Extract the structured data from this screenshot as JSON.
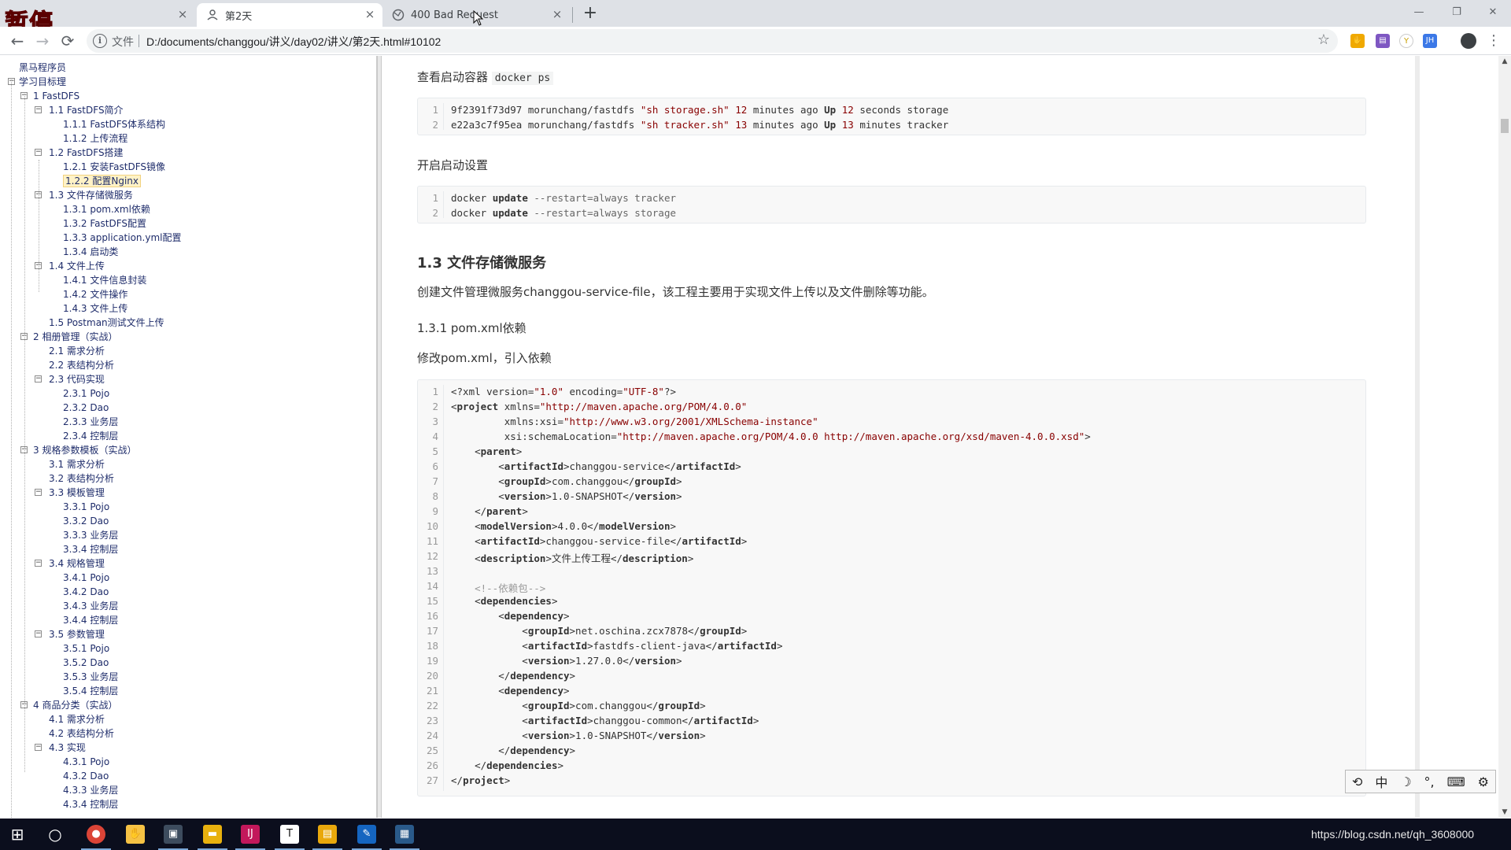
{
  "overlay": {
    "pause_label": "暂停"
  },
  "browser": {
    "tabs": [
      {
        "title": "",
        "close": "×"
      },
      {
        "title": "第2天",
        "close": "×"
      },
      {
        "title": "400 Bad Request",
        "close": "×"
      }
    ],
    "new_tab": "+",
    "window_controls": {
      "minimize": "—",
      "restore": "❐",
      "close": "✕"
    },
    "nav": {
      "back": "←",
      "forward": "→",
      "reload": "⟳"
    },
    "address": {
      "info": "i",
      "scheme_label": "文件",
      "url": "D:/documents/changgou/讲义/day02/讲义/第2天.html#10102",
      "star": "☆"
    },
    "menu": "⋮"
  },
  "toc": {
    "items": [
      {
        "label": "黑马程序员",
        "level": 0
      },
      {
        "label": "学习目标理",
        "level": 0
      },
      {
        "label": "1 FastDFS",
        "level": 1
      },
      {
        "label": "1.1 FastDFS简介",
        "level": 2
      },
      {
        "label": "1.1.1 FastDFS体系结构",
        "level": 3
      },
      {
        "label": "1.1.2 上传流程",
        "level": 3
      },
      {
        "label": "1.2 FastDFS搭建",
        "level": 2
      },
      {
        "label": "1.2.1 安装FastDFS镜像",
        "level": 3
      },
      {
        "label": "1.2.2 配置Nginx",
        "level": 3,
        "selected": true
      },
      {
        "label": "1.3 文件存储微服务",
        "level": 2
      },
      {
        "label": "1.3.1 pom.xml依赖",
        "level": 3
      },
      {
        "label": "1.3.2 FastDFS配置",
        "level": 3
      },
      {
        "label": "1.3.3 application.yml配置",
        "level": 3
      },
      {
        "label": "1.3.4 启动类",
        "level": 3
      },
      {
        "label": "1.4 文件上传",
        "level": 2
      },
      {
        "label": "1.4.1 文件信息封装",
        "level": 3
      },
      {
        "label": "1.4.2 文件操作",
        "level": 3
      },
      {
        "label": "1.4.3 文件上传",
        "level": 3
      },
      {
        "label": "1.5 Postman测试文件上传",
        "level": 2
      },
      {
        "label": "2 相册管理（实战）",
        "level": 1
      },
      {
        "label": "2.1 需求分析",
        "level": 2
      },
      {
        "label": "2.2 表结构分析",
        "level": 2
      },
      {
        "label": "2.3 代码实现",
        "level": 2
      },
      {
        "label": "2.3.1 Pojo",
        "level": 3
      },
      {
        "label": "2.3.2 Dao",
        "level": 3
      },
      {
        "label": "2.3.3 业务层",
        "level": 3
      },
      {
        "label": "2.3.4 控制层",
        "level": 3
      },
      {
        "label": "3 规格参数模板（实战）",
        "level": 1
      },
      {
        "label": "3.1 需求分析",
        "level": 2
      },
      {
        "label": "3.2 表结构分析",
        "level": 2
      },
      {
        "label": "3.3 模板管理",
        "level": 2
      },
      {
        "label": "3.3.1 Pojo",
        "level": 3
      },
      {
        "label": "3.3.2 Dao",
        "level": 3
      },
      {
        "label": "3.3.3 业务层",
        "level": 3
      },
      {
        "label": "3.3.4 控制层",
        "level": 3
      },
      {
        "label": "3.4 规格管理",
        "level": 2
      },
      {
        "label": "3.4.1 Pojo",
        "level": 3
      },
      {
        "label": "3.4.2 Dao",
        "level": 3
      },
      {
        "label": "3.4.3 业务层",
        "level": 3
      },
      {
        "label": "3.4.4 控制层",
        "level": 3
      },
      {
        "label": "3.5 参数管理",
        "level": 2
      },
      {
        "label": "3.5.1 Pojo",
        "level": 3
      },
      {
        "label": "3.5.2 Dao",
        "level": 3
      },
      {
        "label": "3.5.3 业务层",
        "level": 3
      },
      {
        "label": "3.5.4 控制层",
        "level": 3
      },
      {
        "label": "4 商品分类（实战）",
        "level": 1
      },
      {
        "label": "4.1 需求分析",
        "level": 2
      },
      {
        "label": "4.2 表结构分析",
        "level": 2
      },
      {
        "label": "4.3 实现",
        "level": 2
      },
      {
        "label": "4.3.1 Pojo",
        "level": 3
      },
      {
        "label": "4.3.2 Dao",
        "level": 3
      },
      {
        "label": "4.3.3 业务层",
        "level": 3
      },
      {
        "label": "4.3.4 控制层",
        "level": 3
      }
    ]
  },
  "content": {
    "p_view_containers": "查看启动容器",
    "p_view_containers_code": "docker ps",
    "block1": [
      "9f2391f73d97 morunchang/fastdfs \"sh storage.sh\" 12 minutes ago Up 12 seconds storage",
      "e22a3c7f95ea morunchang/fastdfs \"sh tracker.sh\" 13 minutes ago Up 13 minutes tracker"
    ],
    "p_autostart": "开启启动设置",
    "block2": [
      "docker update --restart=always tracker",
      "docker update --restart=always storage"
    ],
    "h3_file_service": "1.3 文件存储微服务",
    "p_create_service": "创建文件管理微服务changgou-service-file，该工程主要用于实现文件上传以及文件删除等功能。",
    "h4_pom": "1.3.1 pom.xml依赖",
    "p_modify_pom": "修改pom.xml，引入依赖",
    "block3": [
      "<?xml version=\"1.0\" encoding=\"UTF-8\"?>",
      "<project xmlns=\"http://maven.apache.org/POM/4.0.0\"",
      "         xmlns:xsi=\"http://www.w3.org/2001/XMLSchema-instance\"",
      "         xsi:schemaLocation=\"http://maven.apache.org/POM/4.0.0 http://maven.apache.org/xsd/maven-4.0.0.xsd\">",
      "    <parent>",
      "        <artifactId>changgou-service</artifactId>",
      "        <groupId>com.changgou</groupId>",
      "        <version>1.0-SNAPSHOT</version>",
      "    </parent>",
      "    <modelVersion>4.0.0</modelVersion>",
      "    <artifactId>changgou-service-file</artifactId>",
      "    <description>文件上传工程</description>",
      "",
      "    <!--依赖包-->",
      "    <dependencies>",
      "        <dependency>",
      "            <groupId>net.oschina.zcx7878</groupId>",
      "            <artifactId>fastdfs-client-java</artifactId>",
      "            <version>1.27.0.0</version>",
      "        </dependency>",
      "        <dependency>",
      "            <groupId>com.changgou</groupId>",
      "            <artifactId>changgou-common</artifactId>",
      "            <version>1.0-SNAPSHOT</version>",
      "        </dependency>",
      "    </dependencies>",
      "</project>"
    ]
  },
  "ime": {
    "items": [
      "⟲",
      "中",
      "☽",
      "°,",
      "⌨",
      "⚙"
    ]
  },
  "taskbar": {
    "start": "⊞",
    "search": "○",
    "tray_text": "https://blog.csdn.net/qh_3608000"
  }
}
